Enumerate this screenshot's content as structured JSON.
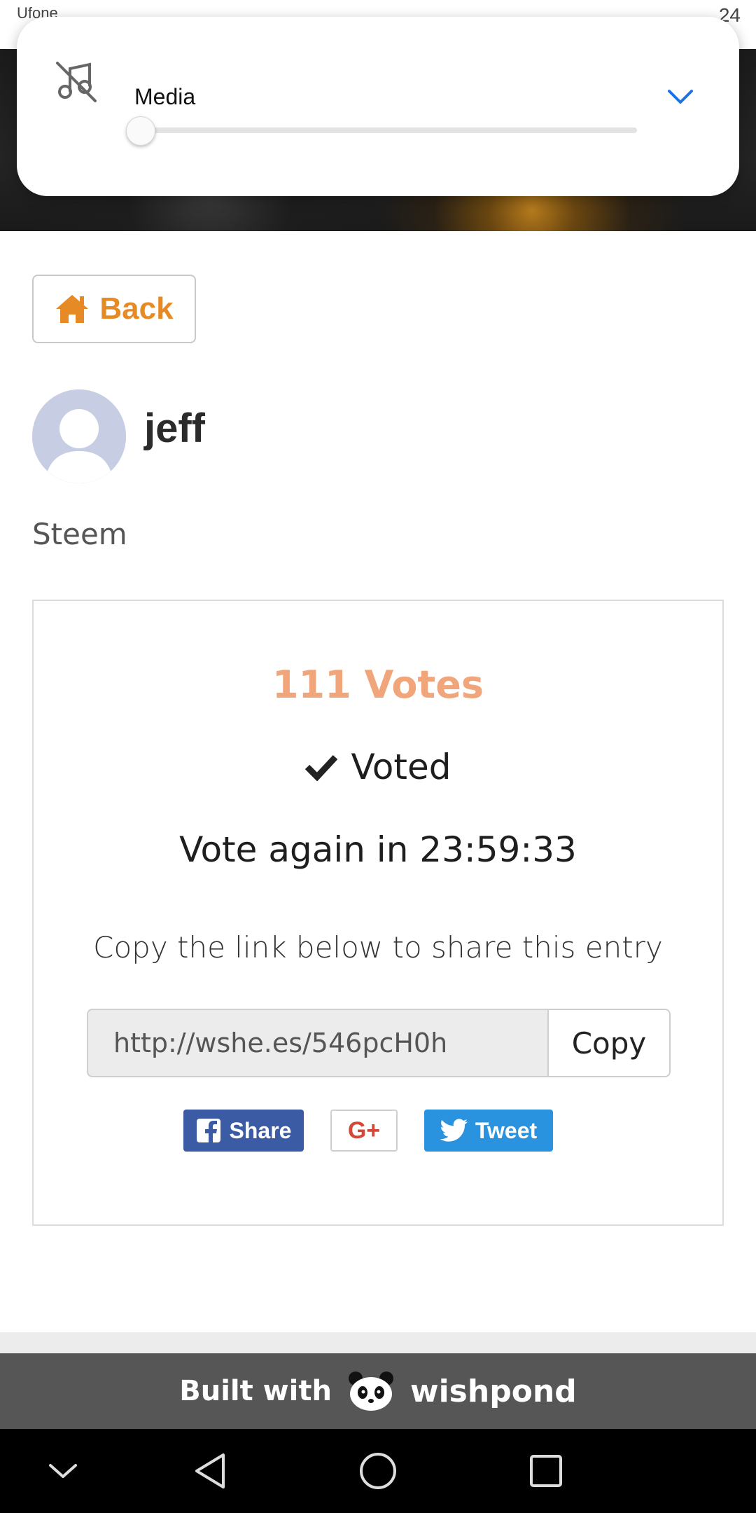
{
  "status_bar": {
    "carrier": "Ufone",
    "right_text": "24"
  },
  "volume_panel": {
    "label": "Media",
    "level": 0
  },
  "back_button": {
    "label": "Back"
  },
  "profile": {
    "username": "jeff",
    "category": "Steem"
  },
  "vote_card": {
    "votes": "111 Votes",
    "voted": "Voted",
    "vote_again": "Vote again in 23:59:33",
    "share_instruction": "Copy the link below to share this entry",
    "link_value": "http://wshe.es/546pcH0h",
    "copy_label": "Copy"
  },
  "social": {
    "facebook_label": "Share",
    "gplus_label": "G+",
    "twitter_label": "Tweet"
  },
  "footer": {
    "built_with": "Built with",
    "brand": "wishpond"
  },
  "colors": {
    "accent_orange": "#e58a25",
    "votes_color": "#f0a67a",
    "facebook_blue": "#3b5ca5",
    "twitter_blue": "#2a93e0",
    "gplus_red": "#d34836",
    "chevron_blue": "#1a73e8"
  },
  "icons": {
    "volume": "music-off-icon",
    "expand": "chevron-down-icon",
    "back": "home-icon",
    "voted": "check-icon",
    "facebook": "facebook-icon",
    "twitter": "twitter-icon",
    "footer_logo": "panda-logo-icon",
    "nav": [
      "collapse-icon",
      "back-triangle-icon",
      "home-circle-icon",
      "recents-square-icon"
    ]
  }
}
